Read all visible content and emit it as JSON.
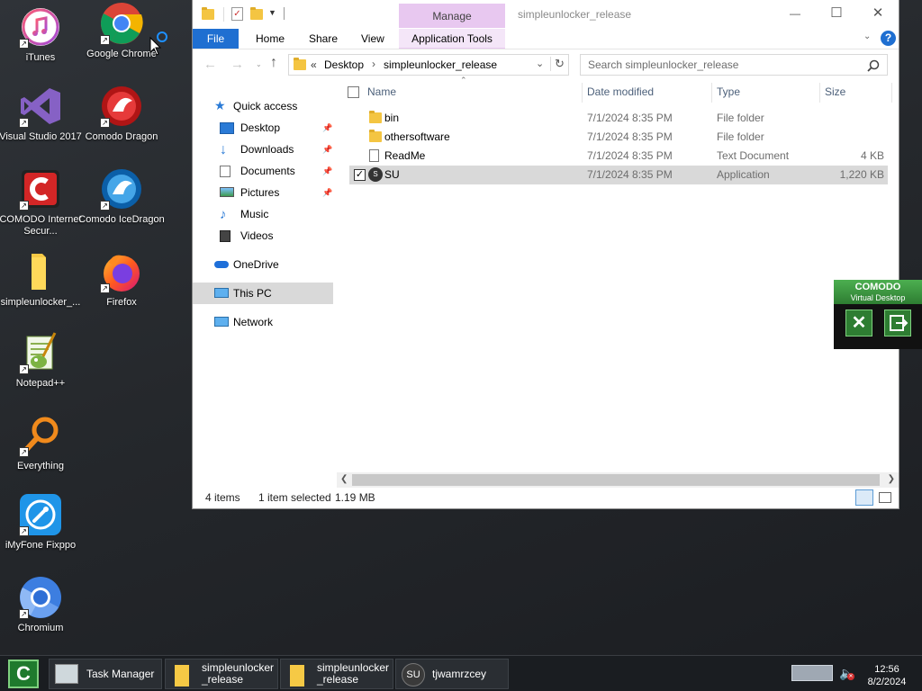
{
  "desktop": {
    "icons": [
      {
        "label": "iTunes"
      },
      {
        "label": "Google Chrome"
      },
      {
        "label": "Visual Studio 2017"
      },
      {
        "label": "Comodo Dragon"
      },
      {
        "label": "COMODO Internet Secur..."
      },
      {
        "label": "Comodo IceDragon"
      },
      {
        "label": "simpleunlocker_..."
      },
      {
        "label": "Firefox"
      },
      {
        "label": "Notepad++"
      },
      {
        "label": "Everything"
      },
      {
        "label": "iMyFone Fixppo"
      },
      {
        "label": "Chromium"
      }
    ]
  },
  "window": {
    "title": "simpleunlocker_release",
    "controls": {
      "minimize": "—",
      "maximize": "☐",
      "close": "✕"
    },
    "ribbon": {
      "context_group": "Manage",
      "tabs": [
        "File",
        "Home",
        "Share",
        "View",
        "Application Tools"
      ],
      "help": "?"
    },
    "address": {
      "prefix": "«",
      "crumbs": [
        "Desktop",
        "simpleunlocker_release"
      ],
      "separator": "›"
    },
    "search": {
      "placeholder": "Search simpleunlocker_release"
    },
    "nav": {
      "quick_access": "Quick access",
      "items": [
        {
          "label": "Desktop",
          "pinned": true
        },
        {
          "label": "Downloads",
          "pinned": true
        },
        {
          "label": "Documents",
          "pinned": true
        },
        {
          "label": "Pictures",
          "pinned": true
        },
        {
          "label": "Music",
          "pinned": false
        },
        {
          "label": "Videos",
          "pinned": false
        }
      ],
      "onedrive": "OneDrive",
      "this_pc": "This PC",
      "network": "Network"
    },
    "columns": [
      "Name",
      "Date modified",
      "Type",
      "Size"
    ],
    "files": [
      {
        "name": "bin",
        "date": "7/1/2024 8:35 PM",
        "type": "File folder",
        "size": ""
      },
      {
        "name": "othersoftware",
        "date": "7/1/2024 8:35 PM",
        "type": "File folder",
        "size": ""
      },
      {
        "name": "ReadMe",
        "date": "7/1/2024 8:35 PM",
        "type": "Text Document",
        "size": "4 KB"
      },
      {
        "name": "SU",
        "date": "7/1/2024 8:35 PM",
        "type": "Application",
        "size": "1,220 KB",
        "selected": true
      }
    ],
    "status": {
      "count": "4 items",
      "selection": "1 item selected",
      "size": "1.19 MB"
    }
  },
  "comodo_panel": {
    "title": "COMODO",
    "subtitle": "Virtual Desktop"
  },
  "taskbar": {
    "items": [
      {
        "label": "Task Manager"
      },
      {
        "label": "simpleunlocker\n_release"
      },
      {
        "label": "simpleunlocker\n_release"
      },
      {
        "label": "tjwamrzcey"
      }
    ],
    "tray": {
      "time": "12:56",
      "date": "8/2/2024"
    }
  },
  "colors": {
    "accent": "#1f6fd1",
    "selection": "#d9d9d9",
    "manage": "#e8c8f0",
    "comodo": "#2e7d32"
  }
}
